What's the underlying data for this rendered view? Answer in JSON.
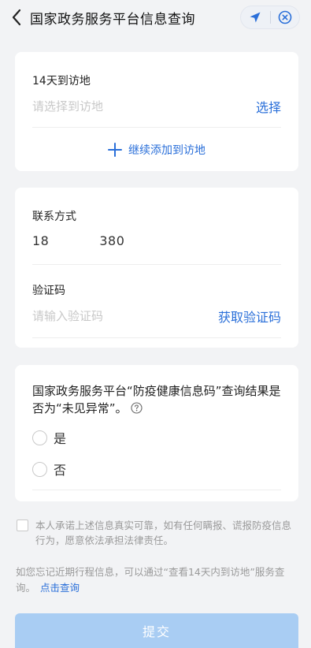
{
  "header": {
    "title": "国家政务服务平台信息查询",
    "back_icon": "chevron-left-icon",
    "location_icon": "location-arrow-icon",
    "close_icon": "close-circle-icon"
  },
  "visited": {
    "label": "14天到访地",
    "placeholder": "请选择到访地",
    "select_label": "选择",
    "add_label": "继续添加到访地"
  },
  "contact": {
    "phone_label": "联系方式",
    "phone_prefix": "18",
    "phone_suffix": "380",
    "code_label": "验证码",
    "code_placeholder": "请输入验证码",
    "get_code_label": "获取验证码"
  },
  "question": {
    "text": "国家政务服务平台“防疫健康信息码”查询结果是否为“未见异常”。",
    "options": [
      "是",
      "否"
    ]
  },
  "agreement": {
    "text": "本人承诺上述信息真实可靠，如有任何瞒报、谎报防疫信息行为，愿意依法承担法律责任。"
  },
  "hint": {
    "text": "如您忘记近期行程信息，可以通过“查看14天内到访地”服务查询。",
    "link": "点击查询"
  },
  "submit": {
    "label": "提交"
  },
  "colors": {
    "accent": "#2a6fd9",
    "submit_bg": "#a9cdf3",
    "page_bg": "#f2f3f5"
  }
}
